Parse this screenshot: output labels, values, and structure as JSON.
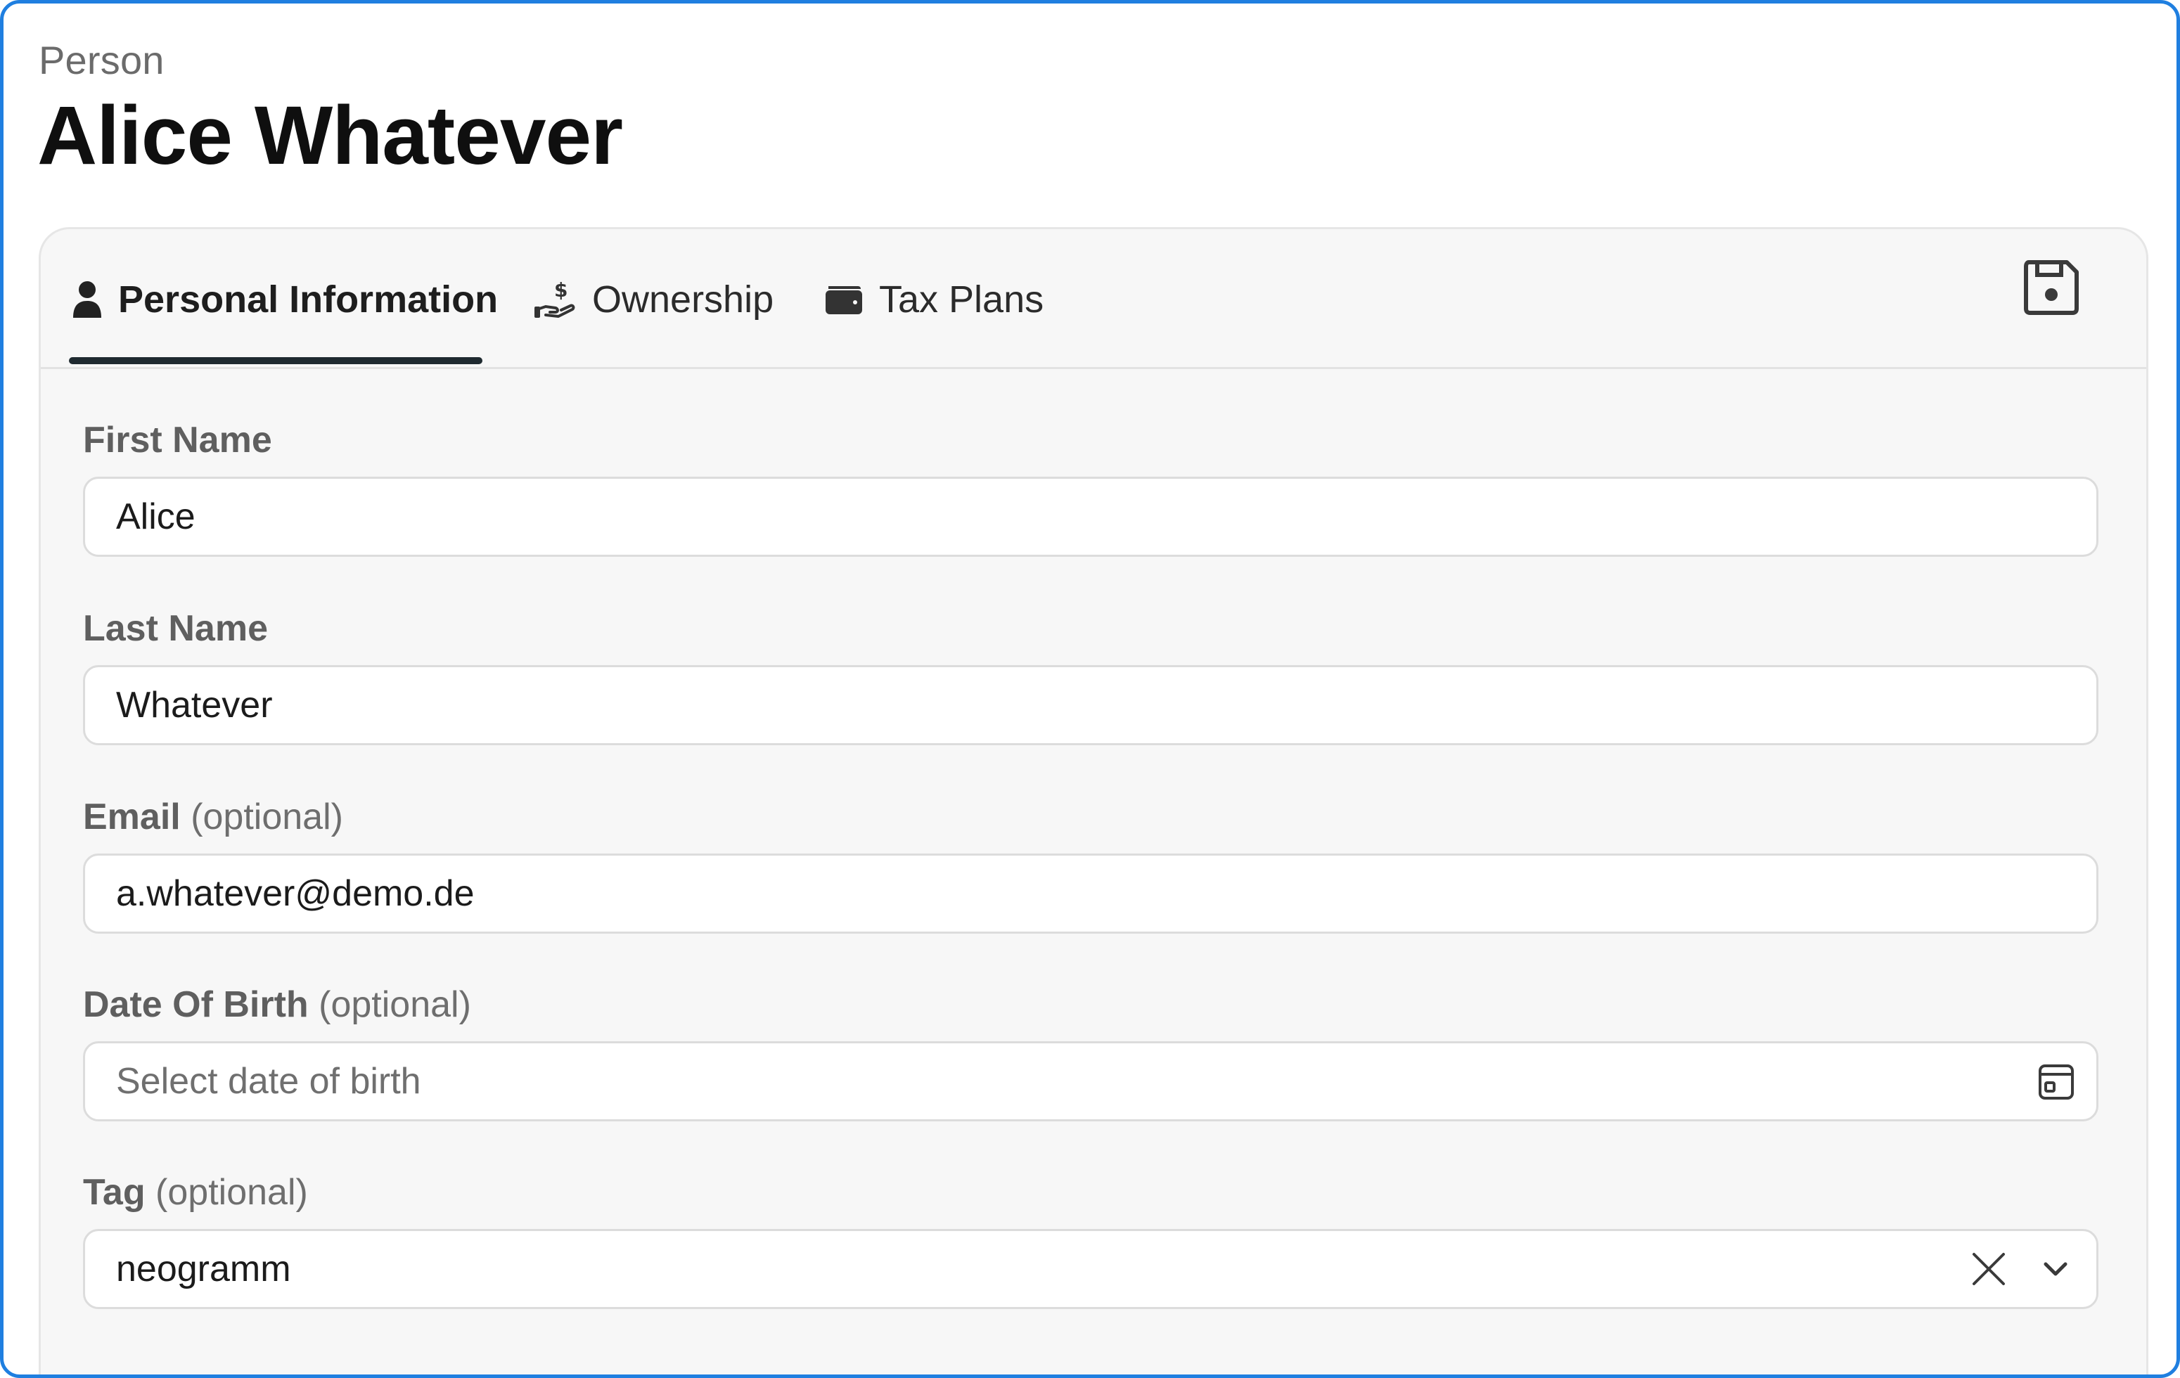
{
  "header": {
    "kicker": "Person",
    "title": "Alice Whatever"
  },
  "tabs": [
    {
      "label": "Personal Information",
      "icon": "person-icon",
      "active": true
    },
    {
      "label": "Ownership",
      "icon": "hand-dollar-icon",
      "active": false
    },
    {
      "label": "Tax Plans",
      "icon": "wallet-icon",
      "active": false
    }
  ],
  "toolbar": {
    "save_icon": "save-icon"
  },
  "form": {
    "first_name": {
      "label": "First Name",
      "value": "Alice"
    },
    "last_name": {
      "label": "Last Name",
      "value": "Whatever"
    },
    "email": {
      "label": "Email",
      "optional": "(optional)",
      "value": "a.whatever@demo.de"
    },
    "dob": {
      "label": "Date Of Birth",
      "optional": "(optional)",
      "placeholder": "Select date of birth",
      "icon": "calendar-icon"
    },
    "tag": {
      "label": "Tag",
      "optional": "(optional)",
      "value": "neogramm",
      "clear_icon": "close-icon",
      "dropdown_icon": "chevron-down-icon"
    }
  },
  "colors": {
    "frame_border": "#1f7fe0",
    "card_bg": "#f7f7f7",
    "tab_underline": "#1f2a30"
  }
}
